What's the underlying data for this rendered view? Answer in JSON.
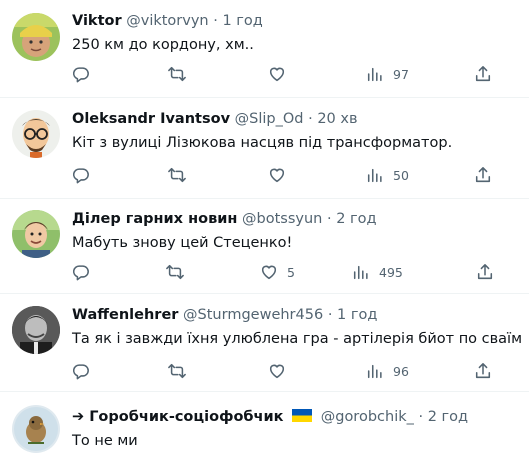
{
  "tweets": [
    {
      "name": "Viktor",
      "handle": "@viktorvyn",
      "time": "1 год",
      "text": "250 км до кордону, хм..",
      "likes": "",
      "views": "97"
    },
    {
      "name": "Oleksandr Ivantsov",
      "handle": "@Slip_Od",
      "time": "20 хв",
      "text": "Кіт з вулиці Лізюкова насцяв під трансформатор.",
      "likes": "",
      "views": "50"
    },
    {
      "name": "Ділер гарних новин",
      "handle": "@botssyun",
      "time": "2 год",
      "text": "Мабуть знову цей Стеценко!",
      "likes": "5",
      "views": "495"
    },
    {
      "name": "Waffenlehrer",
      "handle": "@Sturmgewehr456",
      "time": "1 год",
      "text": "Та як і завжди їхня улюблена гра - артілерія бйот по сваїм",
      "likes": "",
      "views": "96"
    },
    {
      "name": "➔ Горобчик-соціофобчик",
      "handle": "@gorobchik_",
      "time": "2 год",
      "text": "То не ми",
      "likes": "",
      "views": ""
    }
  ],
  "separator": "·",
  "icons": {
    "reply": "reply-icon",
    "retweet": "retweet-icon",
    "like": "heart-icon",
    "views": "views-icon",
    "share": "share-icon",
    "flag": "ukraine-flag-icon"
  },
  "colors": {
    "text_primary": "#0f1419",
    "text_secondary": "#536471",
    "divider": "#eff3f4",
    "flag_blue": "#0057b7",
    "flag_yellow": "#ffd700"
  }
}
